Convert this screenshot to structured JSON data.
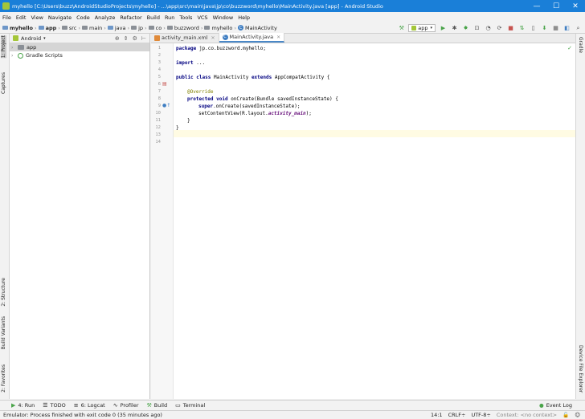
{
  "window": {
    "title": "myhello [C:\\Users\\buzz\\AndroidStudioProjects\\myhello] - ...\\app\\src\\main\\java\\jp\\co\\buzzword\\myhello\\MainActivity.java [app] - Android Studio",
    "minimize": "—",
    "maximize": "☐",
    "close": "✕"
  },
  "menu": [
    "File",
    "Edit",
    "View",
    "Navigate",
    "Code",
    "Analyze",
    "Refactor",
    "Build",
    "Run",
    "Tools",
    "VCS",
    "Window",
    "Help"
  ],
  "breadcrumb": [
    "myhello",
    "app",
    "src",
    "main",
    "java",
    "jp",
    "co",
    "buzzword",
    "myhello",
    "MainActivity"
  ],
  "toolbar": {
    "run_config": "app"
  },
  "left_stripe": {
    "project": "1: Project",
    "captures": "Captures",
    "structure": "2: Structure",
    "build_variants": "Build Variants",
    "favorites": "2: Favorites"
  },
  "right_stripe": {
    "gradle": "Gradle",
    "device_file_explorer": "Device File Explorer"
  },
  "project_panel": {
    "view": "Android",
    "tree": [
      {
        "label": "app",
        "selected": true
      },
      {
        "label": "Gradle Scripts",
        "selected": false
      }
    ]
  },
  "editor": {
    "tabs": [
      {
        "label": "activity_main.xml",
        "active": false
      },
      {
        "label": "MainActivity.java",
        "active": true
      }
    ],
    "line_numbers": [
      "1",
      "2",
      "3",
      "4",
      "5",
      "6",
      "7",
      "8",
      "9",
      "10",
      "11",
      "12",
      "13",
      "14"
    ]
  },
  "code": {
    "l1_kw": "package",
    "l1_rest": " jp.co.buzzword.myhello;",
    "l3_kw": "import",
    "l3_rest": " ...",
    "l6_kw1": "public class",
    "l6_mid": " MainActivity ",
    "l6_kw2": "extends",
    "l6_rest": " AppCompatActivity {",
    "l8_ann": "@Override",
    "l9_kw": "protected void",
    "l9_rest": " onCreate(Bundle savedInstanceState) {",
    "l10_kw": "super",
    "l10_rest": ".onCreate(savedInstanceState);",
    "l11_a": "setContentView(R.layout.",
    "l11_fld": "activity_main",
    "l11_b": ");",
    "l12": "}",
    "l13": "}"
  },
  "bottom_tabs": [
    {
      "label": "4: Run",
      "icon": "▶"
    },
    {
      "label": "TODO",
      "icon": "☰"
    },
    {
      "label": "6: Logcat",
      "icon": "≡"
    },
    {
      "label": "Profiler",
      "icon": "∿"
    },
    {
      "label": "Build",
      "icon": "⚒"
    },
    {
      "label": "Terminal",
      "icon": "▭"
    }
  ],
  "event_log": "Event Log",
  "status": {
    "message": "Emulator: Process finished with exit code 0 (35 minutes ago)",
    "position": "14:1",
    "line_sep": "CRLF÷",
    "encoding": "UTF-8÷",
    "context": "Context: <no context>"
  }
}
